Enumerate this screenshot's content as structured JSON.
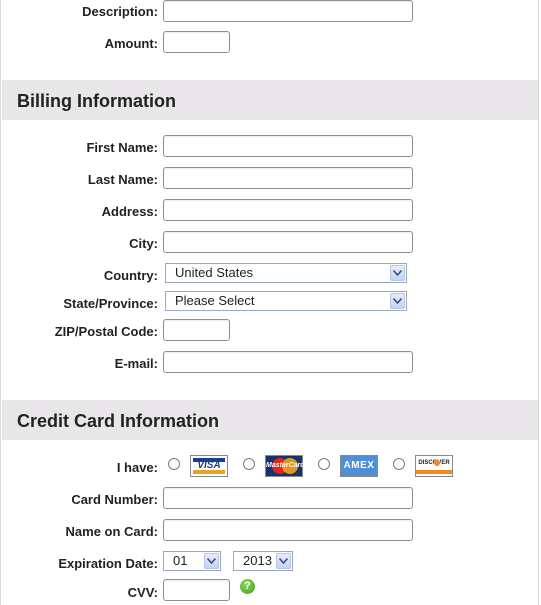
{
  "payment": {
    "description_label": "Description:",
    "description_value": "",
    "amount_label": "Amount:",
    "amount_value": ""
  },
  "billing": {
    "title": "Billing Information",
    "first_name_label": "First Name:",
    "last_name_label": "Last Name:",
    "address_label": "Address:",
    "city_label": "City:",
    "country_label": "Country:",
    "country_value": "United States",
    "state_label": "State/Province:",
    "state_value": "Please Select",
    "zip_label": "ZIP/Postal Code:",
    "email_label": "E-mail:"
  },
  "credit_card": {
    "title": "Credit Card Information",
    "i_have_label": "I have:",
    "card_types": [
      {
        "name": "VISA",
        "icon": "visa-icon"
      },
      {
        "name": "MasterCard",
        "icon": "mastercard-icon"
      },
      {
        "name": "AMEX",
        "icon": "amex-icon"
      },
      {
        "name": "DISCOVER",
        "icon": "discover-icon"
      }
    ],
    "card_number_label": "Card Number:",
    "name_on_card_label": "Name on Card:",
    "expiration_label": "Expiration Date:",
    "exp_month_value": "01",
    "exp_year_value": "2013",
    "cvv_label": "CVV:",
    "cvv_help_icon": "question-icon"
  },
  "colors": {
    "section_bg": "#e8e6e8",
    "input_border": "#8f8f8f",
    "help_green": "#4caf28"
  }
}
